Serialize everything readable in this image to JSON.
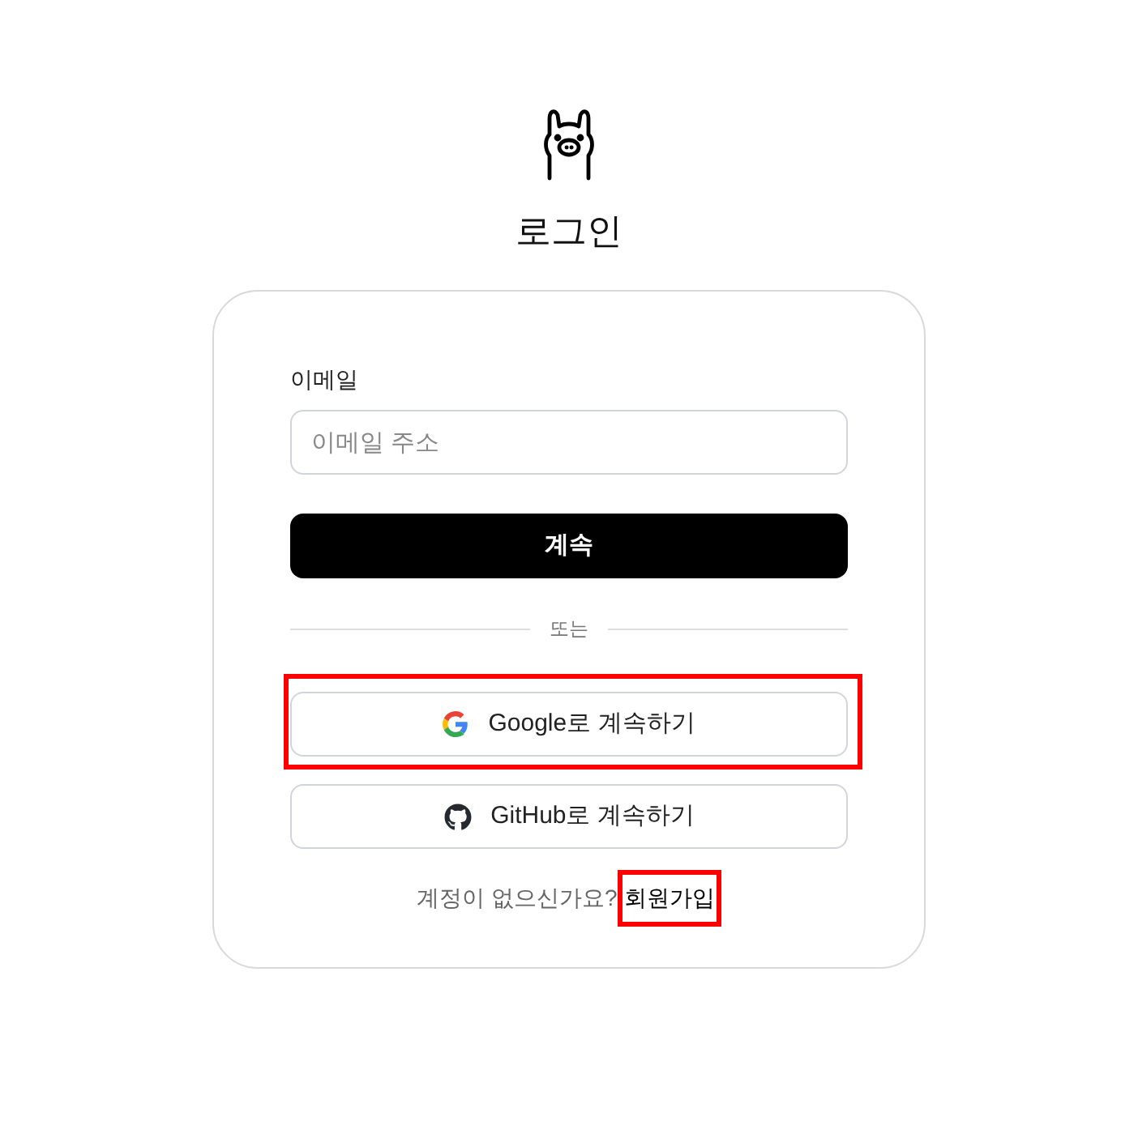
{
  "title": "로그인",
  "email": {
    "label": "이메일",
    "placeholder": "이메일 주소"
  },
  "continue_button": "계속",
  "divider": "또는",
  "providers": [
    {
      "kind": "google",
      "label": "Google로 계속하기",
      "highlighted": true
    },
    {
      "kind": "github",
      "label": "GitHub로 계속하기",
      "highlighted": false
    }
  ],
  "signup": {
    "prompt": "계정이 없으신가요?",
    "link": "회원가입",
    "highlighted": true
  }
}
